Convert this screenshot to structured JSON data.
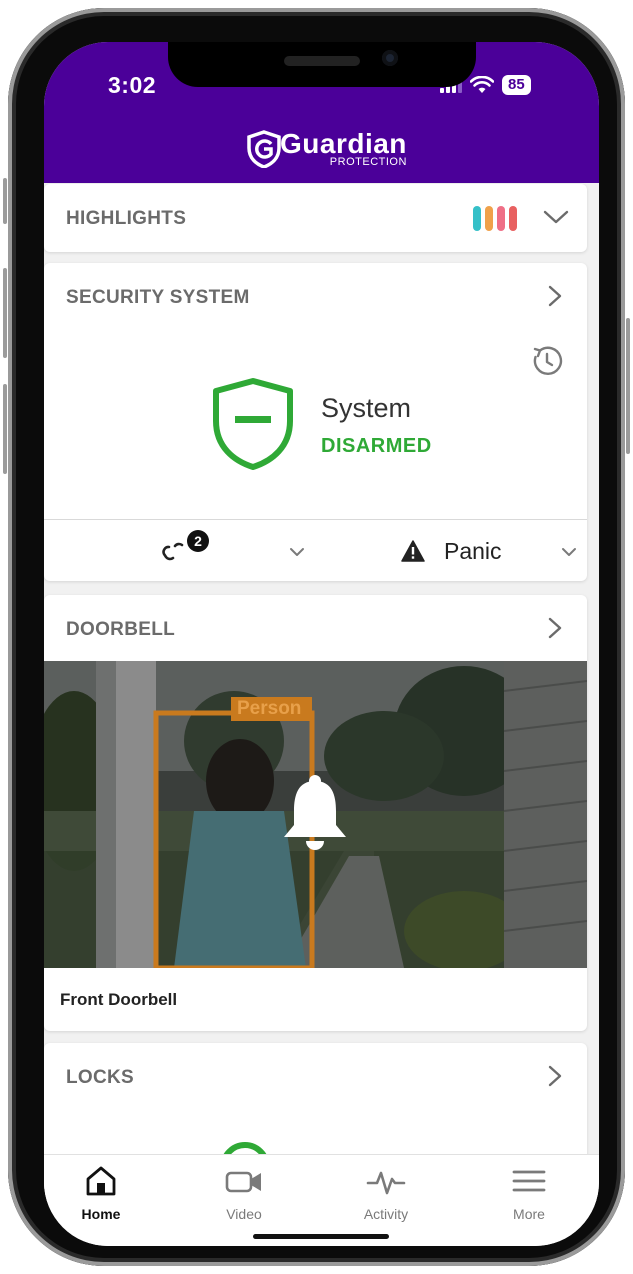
{
  "status_bar": {
    "time": "3:02",
    "battery": "85"
  },
  "brand": {
    "name": "Guardian",
    "sub": "PROTECTION"
  },
  "highlights": {
    "title": "HIGHLIGHTS",
    "stripe_colors": [
      "#35c0c8",
      "#f0a14a",
      "#ef6f86",
      "#e86060"
    ]
  },
  "security": {
    "title": "SECURITY SYSTEM",
    "system_label": "System",
    "state": "DISARMED",
    "sensor_count": "2",
    "panic_label": "Panic"
  },
  "doorbell": {
    "title": "DOORBELL",
    "detection_label": "Person",
    "device_name": "Front Doorbell"
  },
  "locks": {
    "title": "LOCKS"
  },
  "tabs": [
    {
      "label": "Home",
      "icon": "home-icon"
    },
    {
      "label": "Video",
      "icon": "video-icon"
    },
    {
      "label": "Activity",
      "icon": "activity-icon"
    },
    {
      "label": "More",
      "icon": "menu-icon"
    }
  ],
  "colors": {
    "header": "#4b0099",
    "armed_green": "#2fa936",
    "text_grey": "#6b6b6b"
  }
}
